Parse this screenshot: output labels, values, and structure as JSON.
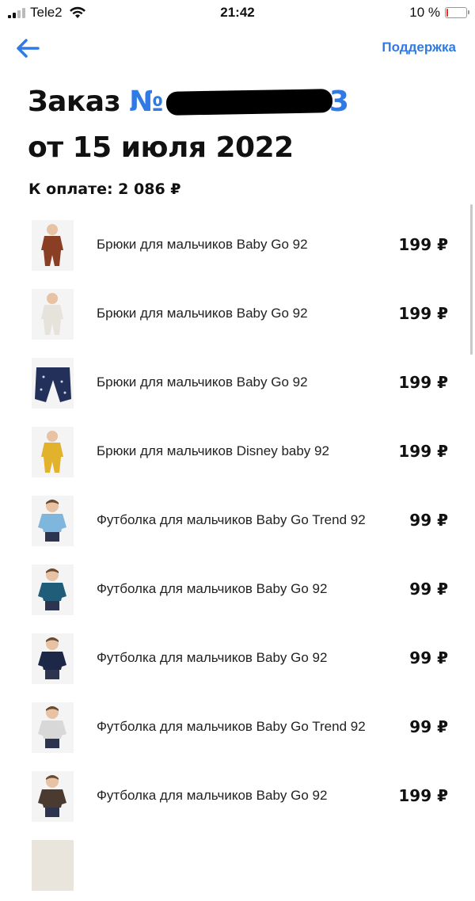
{
  "status_bar": {
    "carrier": "Tele2",
    "time": "21:42",
    "battery": "10 %",
    "battery_level": 0.1
  },
  "nav": {
    "support_label": "Поддержка",
    "accent_color": "#2f7ae5"
  },
  "order": {
    "title_prefix": "Заказ",
    "number_sign": "№",
    "number_tail": "3",
    "date_line": "от 15 июля 2022",
    "to_pay": "К оплате: 2 086 ₽"
  },
  "items": [
    {
      "name": "Брюки для мальчиков Baby Go 92",
      "price": "199 ₽"
    },
    {
      "name": "Брюки для мальчиков Baby Go 92",
      "price": "199 ₽"
    },
    {
      "name": "Брюки для мальчиков Baby Go 92",
      "price": "199 ₽"
    },
    {
      "name": "Брюки для мальчиков Disney baby 92",
      "price": "199 ₽"
    },
    {
      "name": "Футболка для мальчиков Baby Go Trend 92",
      "price": "99 ₽"
    },
    {
      "name": "Футболка для мальчиков Baby Go 92",
      "price": "99 ₽"
    },
    {
      "name": "Футболка для мальчиков Baby Go 92",
      "price": "99 ₽"
    },
    {
      "name": "Футболка для мальчиков Baby Go Trend 92",
      "price": "99 ₽"
    },
    {
      "name": "Футболка для мальчиков Baby Go 92",
      "price": "199 ₽"
    }
  ]
}
